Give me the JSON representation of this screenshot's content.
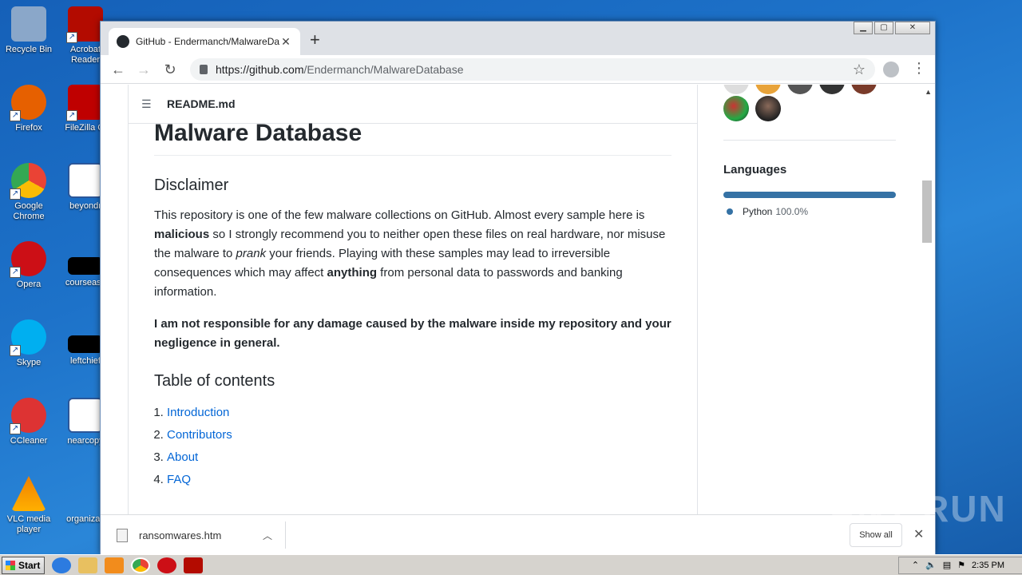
{
  "desktop": {
    "icons": [
      {
        "label": "Recycle Bin",
        "color": "#8aa7c9"
      },
      {
        "label": "Acrobat Reader",
        "color": "#b30b00"
      },
      {
        "label": "Firefox",
        "color": "#e66000"
      },
      {
        "label": "FileZilla Cl",
        "color": "#bf0000"
      },
      {
        "label": "Google Chrome",
        "color": "#34a853"
      },
      {
        "label": "beyondr",
        "color": "#2b579a"
      },
      {
        "label": "Opera",
        "color": "#cc0f16"
      },
      {
        "label": "courseass",
        "color": "#000000"
      },
      {
        "label": "Skype",
        "color": "#00aff0"
      },
      {
        "label": "leftchief",
        "color": "#000000"
      },
      {
        "label": "CCleaner",
        "color": "#d33"
      },
      {
        "label": "nearcopy",
        "color": "#2b579a"
      },
      {
        "label": "VLC media player",
        "color": "#f08000"
      },
      {
        "label": "organizati",
        "color": "#1560b8"
      }
    ]
  },
  "browser": {
    "tab_title": "GitHub - Endermanch/MalwareDatab",
    "tab_close": "✕",
    "new_tab": "+",
    "url_domain": "https://github.com",
    "url_path": "/Endermanch/MalwareDatabase",
    "win_min": "▁",
    "win_max": "▢",
    "win_close": "✕"
  },
  "readme": {
    "filename": "README.md",
    "title": "Malware Database",
    "disclaimer_heading": "Disclaimer",
    "p1_a": "This repository is one of the few malware collections on GitHub. Almost every sample here is ",
    "p1_b": "malicious",
    "p1_c": " so I strongly recommend you to neither open these files on real hardware, nor misuse the malware to ",
    "p1_d": "prank",
    "p1_e": " your friends. Playing with these samples may lead to irreversible consequences which may affect ",
    "p1_f": "anything",
    "p1_g": " from personal data to passwords and banking information.",
    "p2": "I am not responsible for any damage caused by the malware inside my repository and your negligence in general.",
    "toc_heading": "Table of contents",
    "toc": [
      "Introduction",
      "Contributors",
      "About",
      "FAQ"
    ]
  },
  "sidebar": {
    "languages_title": "Languages",
    "language": "Python",
    "language_pct": "100.0%",
    "language_color": "#3572A5"
  },
  "downloads": {
    "file": "ransomwares.htm",
    "show_all": "Show all",
    "close": "✕"
  },
  "taskbar": {
    "start": "Start",
    "clock": "2:35 PM"
  },
  "watermark": "ANY RUN"
}
